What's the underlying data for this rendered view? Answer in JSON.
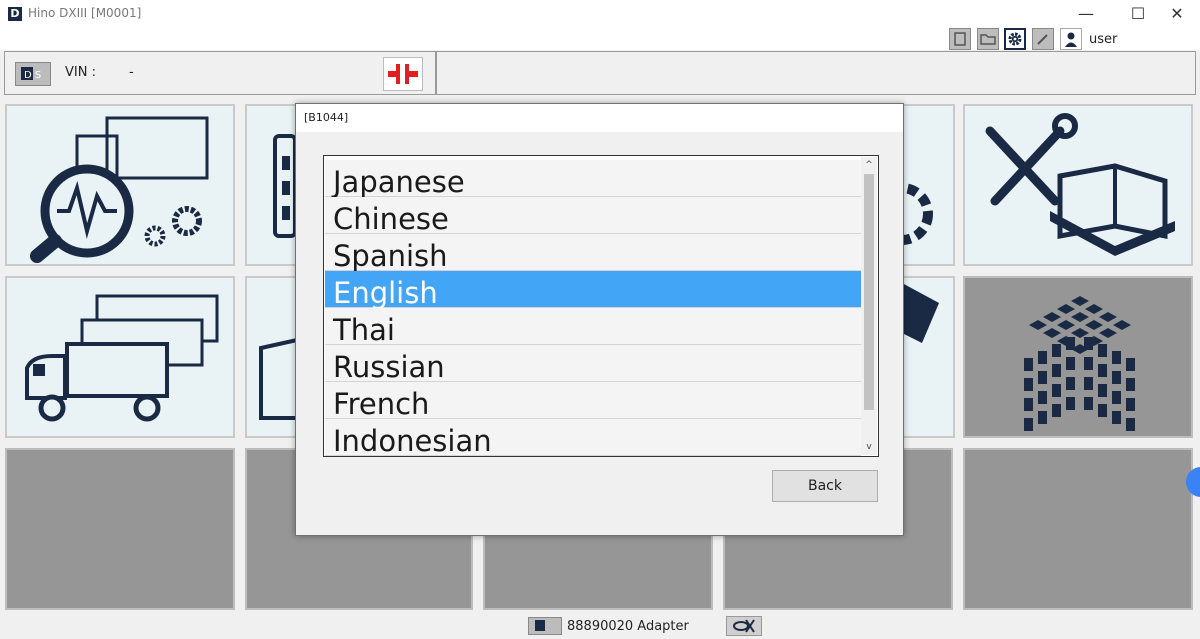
{
  "window": {
    "title": "Hino DXIII [M0001]",
    "app_icon_letter": "D",
    "controls": {
      "minimize": "—",
      "maximize": "☐",
      "close": "✕"
    }
  },
  "toolbar": {
    "icons": [
      "print-icon",
      "folder-icon",
      "gear-icon",
      "edit-icon",
      "user-icon"
    ],
    "username": "user"
  },
  "vin": {
    "label": "VIN :",
    "value": "-",
    "logo_text": "D S"
  },
  "tiles": {
    "row1": [
      "diagnosis-truck-magnifier-icon",
      "list-icon",
      "gear-icon",
      "tools-manual-icon"
    ],
    "row2": [
      "trucks-fleet-icon",
      "folder-icon",
      "card-icon",
      "cube-grid-icon"
    ]
  },
  "dialog": {
    "title": "[B1044]",
    "items": [
      "Japanese",
      "Chinese",
      "Spanish",
      "English",
      "Thai",
      "Russian",
      "French",
      "Indonesian"
    ],
    "selected": "English",
    "back_label": "Back",
    "scroll_up": "^",
    "scroll_down": "v"
  },
  "status": {
    "adapter_text": "88890020 Adapter"
  },
  "colors": {
    "selection": "#42a5f5",
    "icon_navy": "#1a2a44",
    "connector_red": "#e02020",
    "tile_bg": "#e9f3f5",
    "tile_gray": "#969696"
  }
}
